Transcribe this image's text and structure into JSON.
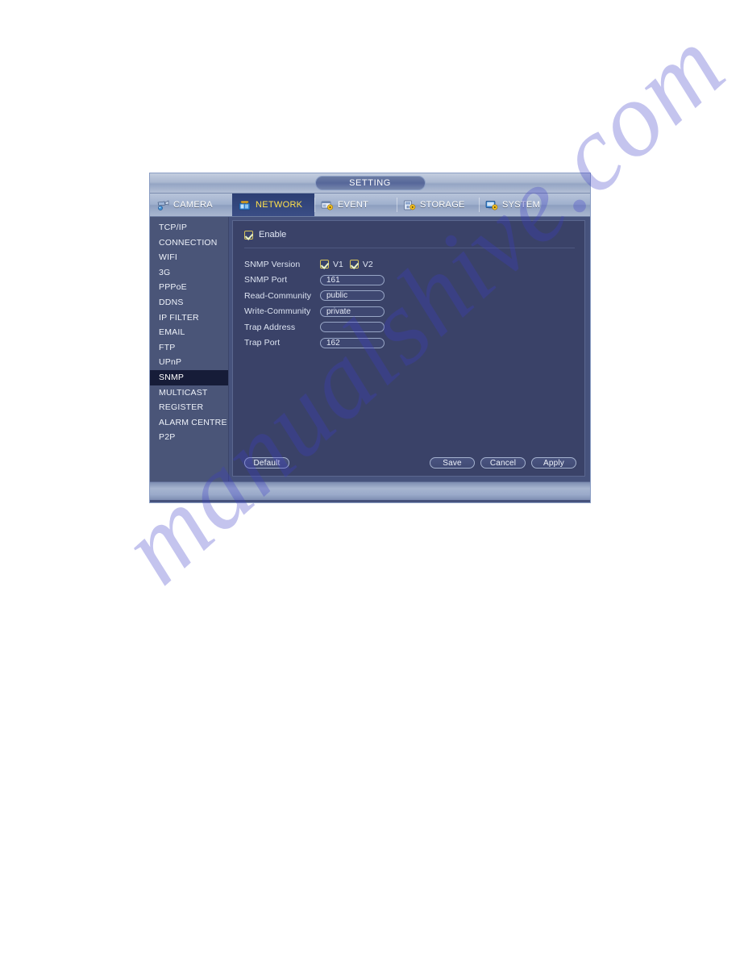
{
  "window": {
    "title": "SETTING"
  },
  "tabs": [
    {
      "label": "CAMERA",
      "icon": "camera-icon",
      "active": false
    },
    {
      "label": "NETWORK",
      "icon": "network-icon",
      "active": true
    },
    {
      "label": "EVENT",
      "icon": "event-icon",
      "active": false
    },
    {
      "label": "STORAGE",
      "icon": "storage-icon",
      "active": false
    },
    {
      "label": "SYSTEM",
      "icon": "system-icon",
      "active": false
    }
  ],
  "sidebar": {
    "selected": "SNMP",
    "items": [
      {
        "label": "TCP/IP"
      },
      {
        "label": "CONNECTION"
      },
      {
        "label": "WIFI"
      },
      {
        "label": "3G"
      },
      {
        "label": "PPPoE"
      },
      {
        "label": "DDNS"
      },
      {
        "label": "IP FILTER"
      },
      {
        "label": "EMAIL"
      },
      {
        "label": "FTP"
      },
      {
        "label": "UPnP"
      },
      {
        "label": "SNMP"
      },
      {
        "label": "MULTICAST"
      },
      {
        "label": "REGISTER"
      },
      {
        "label": "ALARM CENTRE"
      },
      {
        "label": "P2P"
      }
    ]
  },
  "form": {
    "enable": {
      "label": "Enable",
      "checked": true
    },
    "snmp_version": {
      "label": "SNMP Version",
      "options": [
        {
          "label": "V1",
          "checked": true
        },
        {
          "label": "V2",
          "checked": true
        }
      ]
    },
    "snmp_port": {
      "label": "SNMP Port",
      "value": "161",
      "placeholder": ""
    },
    "read_community": {
      "label": "Read-Community",
      "value": "public",
      "placeholder": ""
    },
    "write_community": {
      "label": "Write-Community",
      "value": "private",
      "placeholder": ""
    },
    "trap_address": {
      "label": "Trap Address",
      "value": "",
      "placeholder": ""
    },
    "trap_port": {
      "label": "Trap Port",
      "value": "162",
      "placeholder": ""
    }
  },
  "buttons": {
    "default": "Default",
    "save": "Save",
    "cancel": "Cancel",
    "apply": "Apply"
  },
  "watermark": {
    "text": "manualshive.com"
  },
  "colors": {
    "accent_active_tab_text": "#ffe14d",
    "panel_bg": "#3a4268",
    "sidebar_bg": "#4a5578",
    "sidebar_selected_bg": "#161c38",
    "checkbox_border": "#d7c45a"
  }
}
